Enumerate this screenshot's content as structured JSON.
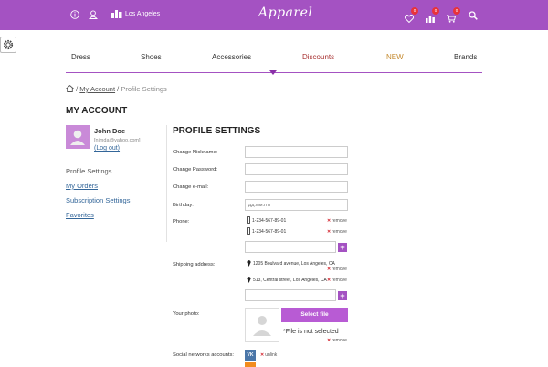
{
  "header": {
    "city": "Los Angeles",
    "logo": "Apparel",
    "icons": [
      "info-icon",
      "user-icon",
      "city-icon",
      "heart-icon",
      "compare-icon",
      "cart-icon",
      "search-icon"
    ],
    "badges": {
      "wishlist": "0",
      "compare": "0",
      "cart": "0"
    },
    "accent": "#a452c2"
  },
  "nav": {
    "items": [
      "Dress",
      "Shoes",
      "Accessories",
      "Discounts",
      "NEW",
      "Brands"
    ]
  },
  "breadcrumb": {
    "sep1": "/",
    "account": "My Account",
    "sep2": "/",
    "current": "Profile Settings"
  },
  "account": {
    "title": "MY ACCOUNT",
    "name": "John Doe",
    "email": "[nimda@yahoo.com]",
    "logout": "(Log out)",
    "menu": [
      "Profile Settings",
      "My Orders",
      "Subscription Settings",
      "Favorites"
    ]
  },
  "profile": {
    "title": "PROFILE SETTINGS",
    "labels": {
      "nickname": "Change Nickname:",
      "password": "Change Password:",
      "email": "Change e-mail:",
      "birthday": "Birthday:",
      "phone": "Phone:",
      "shipping": "Shipping address:",
      "photo": "Your photo:",
      "social": "Social networks accounts:"
    },
    "birthday_placeholder": "дд.мм.гггг",
    "phones": [
      "1-234-567-89-01",
      "1-234-567-89-01"
    ],
    "addresses": [
      "1205 Boulvard avenue, Los Angeles, CA",
      "513, Central street, Los Angeles, CA"
    ],
    "remove_label": "remove",
    "unlink_label": "unlink",
    "select_file": "Select file",
    "file_note": "*File is not selected",
    "social_vk": "VK",
    "plus": "+"
  }
}
